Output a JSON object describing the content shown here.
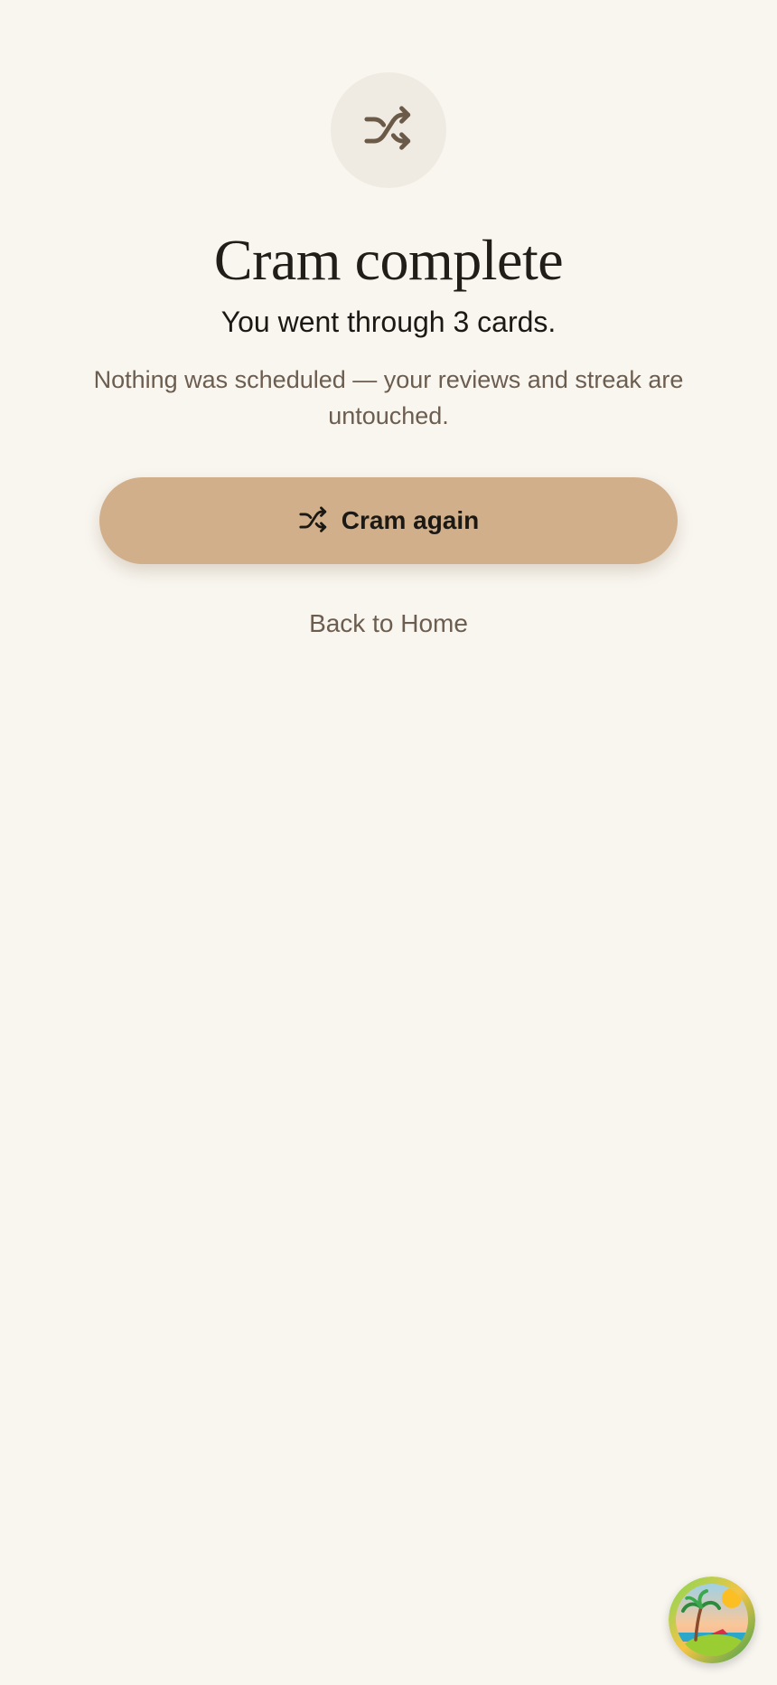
{
  "hero": {
    "icon": "shuffle-icon"
  },
  "title": "Cram complete",
  "subtitle": "You went through 3 cards.",
  "note": "Nothing was scheduled — your reviews and streak are untouched.",
  "actions": {
    "cram_again_label": "Cram again",
    "cram_again_icon": "shuffle-icon",
    "back_label": "Back to Home"
  },
  "avatar": {
    "icon": "beach-avatar-icon"
  },
  "colors": {
    "background": "#f9f6f0",
    "accent": "#d1af8a",
    "icon_circle": "#f0ebe2",
    "muted_text": "#6b5d4f"
  }
}
